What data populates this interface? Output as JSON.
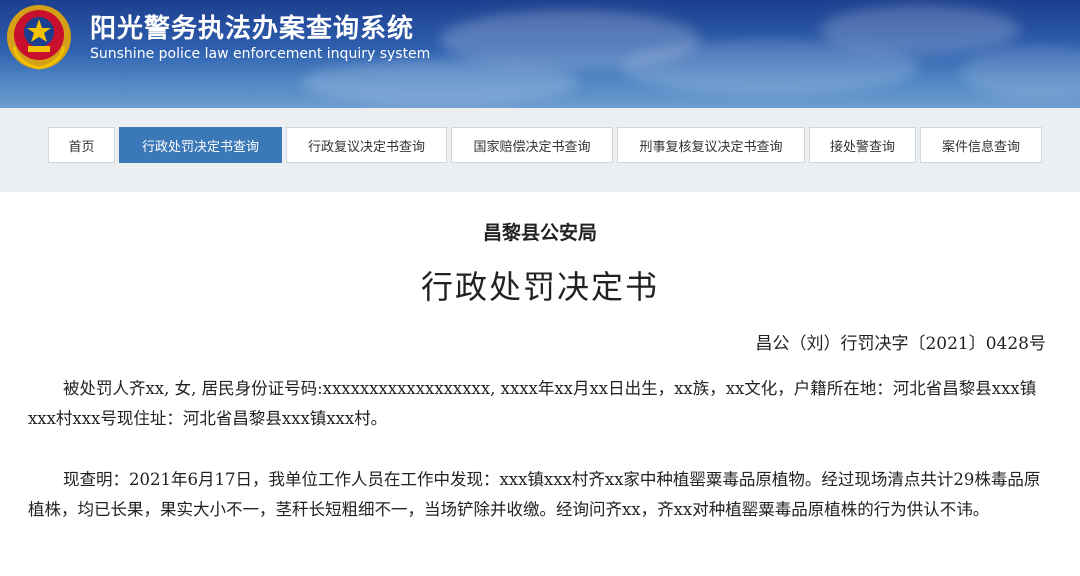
{
  "header": {
    "title_cn": "阳光警务执法办案查询系统",
    "title_en": "Sunshine police law enforcement inquiry system",
    "emblem_icon": "police-emblem-icon"
  },
  "nav": {
    "items": [
      {
        "label": "首页",
        "active": false
      },
      {
        "label": "行政处罚决定书查询",
        "active": true
      },
      {
        "label": "行政复议决定书查询",
        "active": false
      },
      {
        "label": "国家赔偿决定书查询",
        "active": false
      },
      {
        "label": "刑事复核复议决定书查询",
        "active": false
      },
      {
        "label": "接处警查询",
        "active": false
      },
      {
        "label": "案件信息查询",
        "active": false
      }
    ],
    "active_color": "#3b78b7"
  },
  "document": {
    "agency": "昌黎县公安局",
    "title": "行政处罚决定书",
    "number": "昌公（刘）行罚决字〔2021〕0428号",
    "paragraph1": "被处罚人齐xx, 女, 居民身份证号码:xxxxxxxxxxxxxxxxxx, xxxx年xx月xx日出生，xx族，xx文化，户籍所在地：河北省昌黎县xxx镇xxx村xxx号现住址：河北省昌黎县xxx镇xxx村。",
    "paragraph2": "现查明：2021年6月17日，我单位工作人员在工作中发现：xxx镇xxx村齐xx家中种植罂粟毒品原植物。经过现场清点共计29株毒品原植株，均已长果，果实大小不一，茎秆长短粗细不一，当场铲除并收缴。经询问齐xx，齐xx对种植罂粟毒品原植株的行为供认不讳。"
  }
}
